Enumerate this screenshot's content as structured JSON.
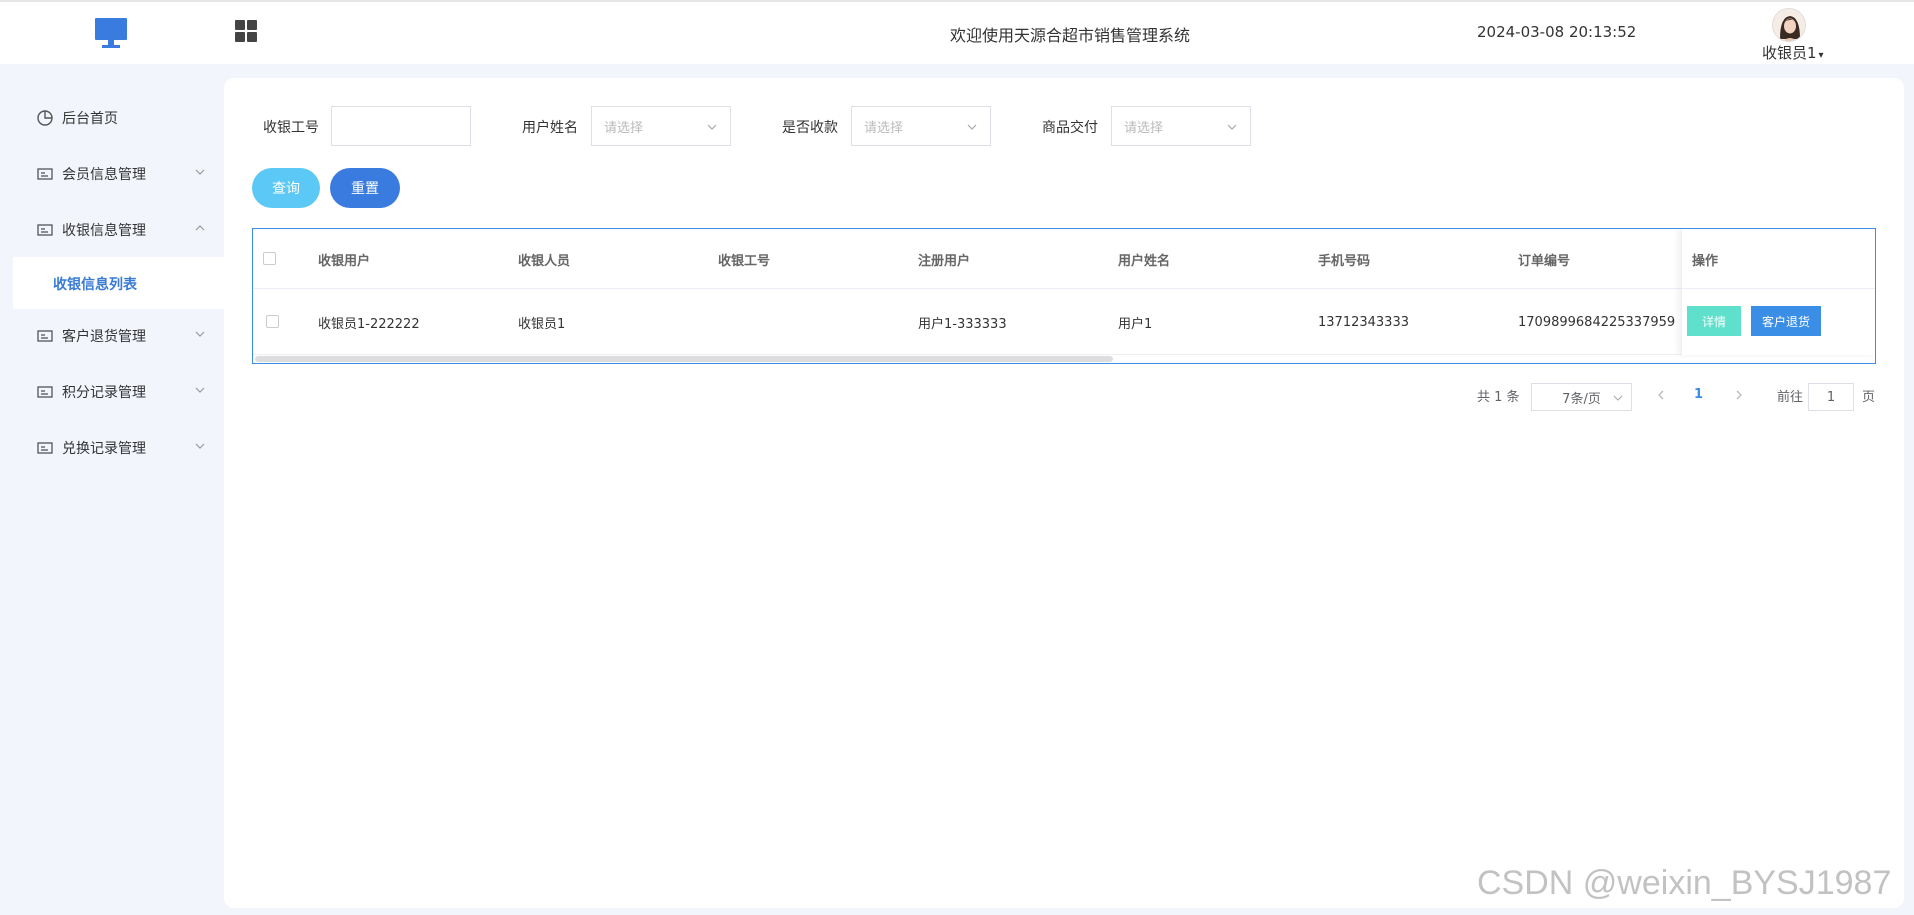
{
  "header": {
    "title": "欢迎使用天源合超市销售管理系统",
    "datetime": "2024-03-08 20:13:52",
    "user": "收银员1"
  },
  "sidebar": {
    "items": [
      {
        "label": "后台首页"
      },
      {
        "label": "会员信息管理"
      },
      {
        "label": "收银信息管理"
      },
      {
        "label": "客户退货管理"
      },
      {
        "label": "积分记录管理"
      },
      {
        "label": "兑换记录管理"
      }
    ],
    "submenu": {
      "label": "收银信息列表"
    }
  },
  "filters": {
    "cashier_id": {
      "label": "收银工号",
      "value": "",
      "placeholder": ""
    },
    "username": {
      "label": "用户姓名",
      "placeholder": "请选择"
    },
    "paid": {
      "label": "是否收款",
      "placeholder": "请选择"
    },
    "delivered": {
      "label": "商品交付",
      "placeholder": "请选择"
    }
  },
  "buttons": {
    "query": "查询",
    "reset": "重置"
  },
  "table": {
    "columns": [
      "收银用户",
      "收银人员",
      "收银工号",
      "注册用户",
      "用户姓名",
      "手机号码",
      "订单编号",
      "操作"
    ],
    "rows": [
      {
        "cashier_user": "收银员1-222222",
        "cashier_staff": "收银员1",
        "cashier_id": "",
        "reg_user": "用户1-333333",
        "username": "用户1",
        "phone": "13712343333",
        "order_no": "1709899684225337959",
        "detail_label": "详情",
        "return_label": "客户退货"
      }
    ]
  },
  "pagination": {
    "total": "共 1 条",
    "page_size": "7条/页",
    "current": "1",
    "goto_label": "前往",
    "goto_value": "1",
    "page_suffix": "页"
  },
  "watermark": "CSDN @weixin_BYSJ1987",
  "colors": {
    "accent": "#3a7be0",
    "query": "#5bc8f5",
    "detail": "#5fe0cd",
    "border": "#3a8ee6"
  }
}
